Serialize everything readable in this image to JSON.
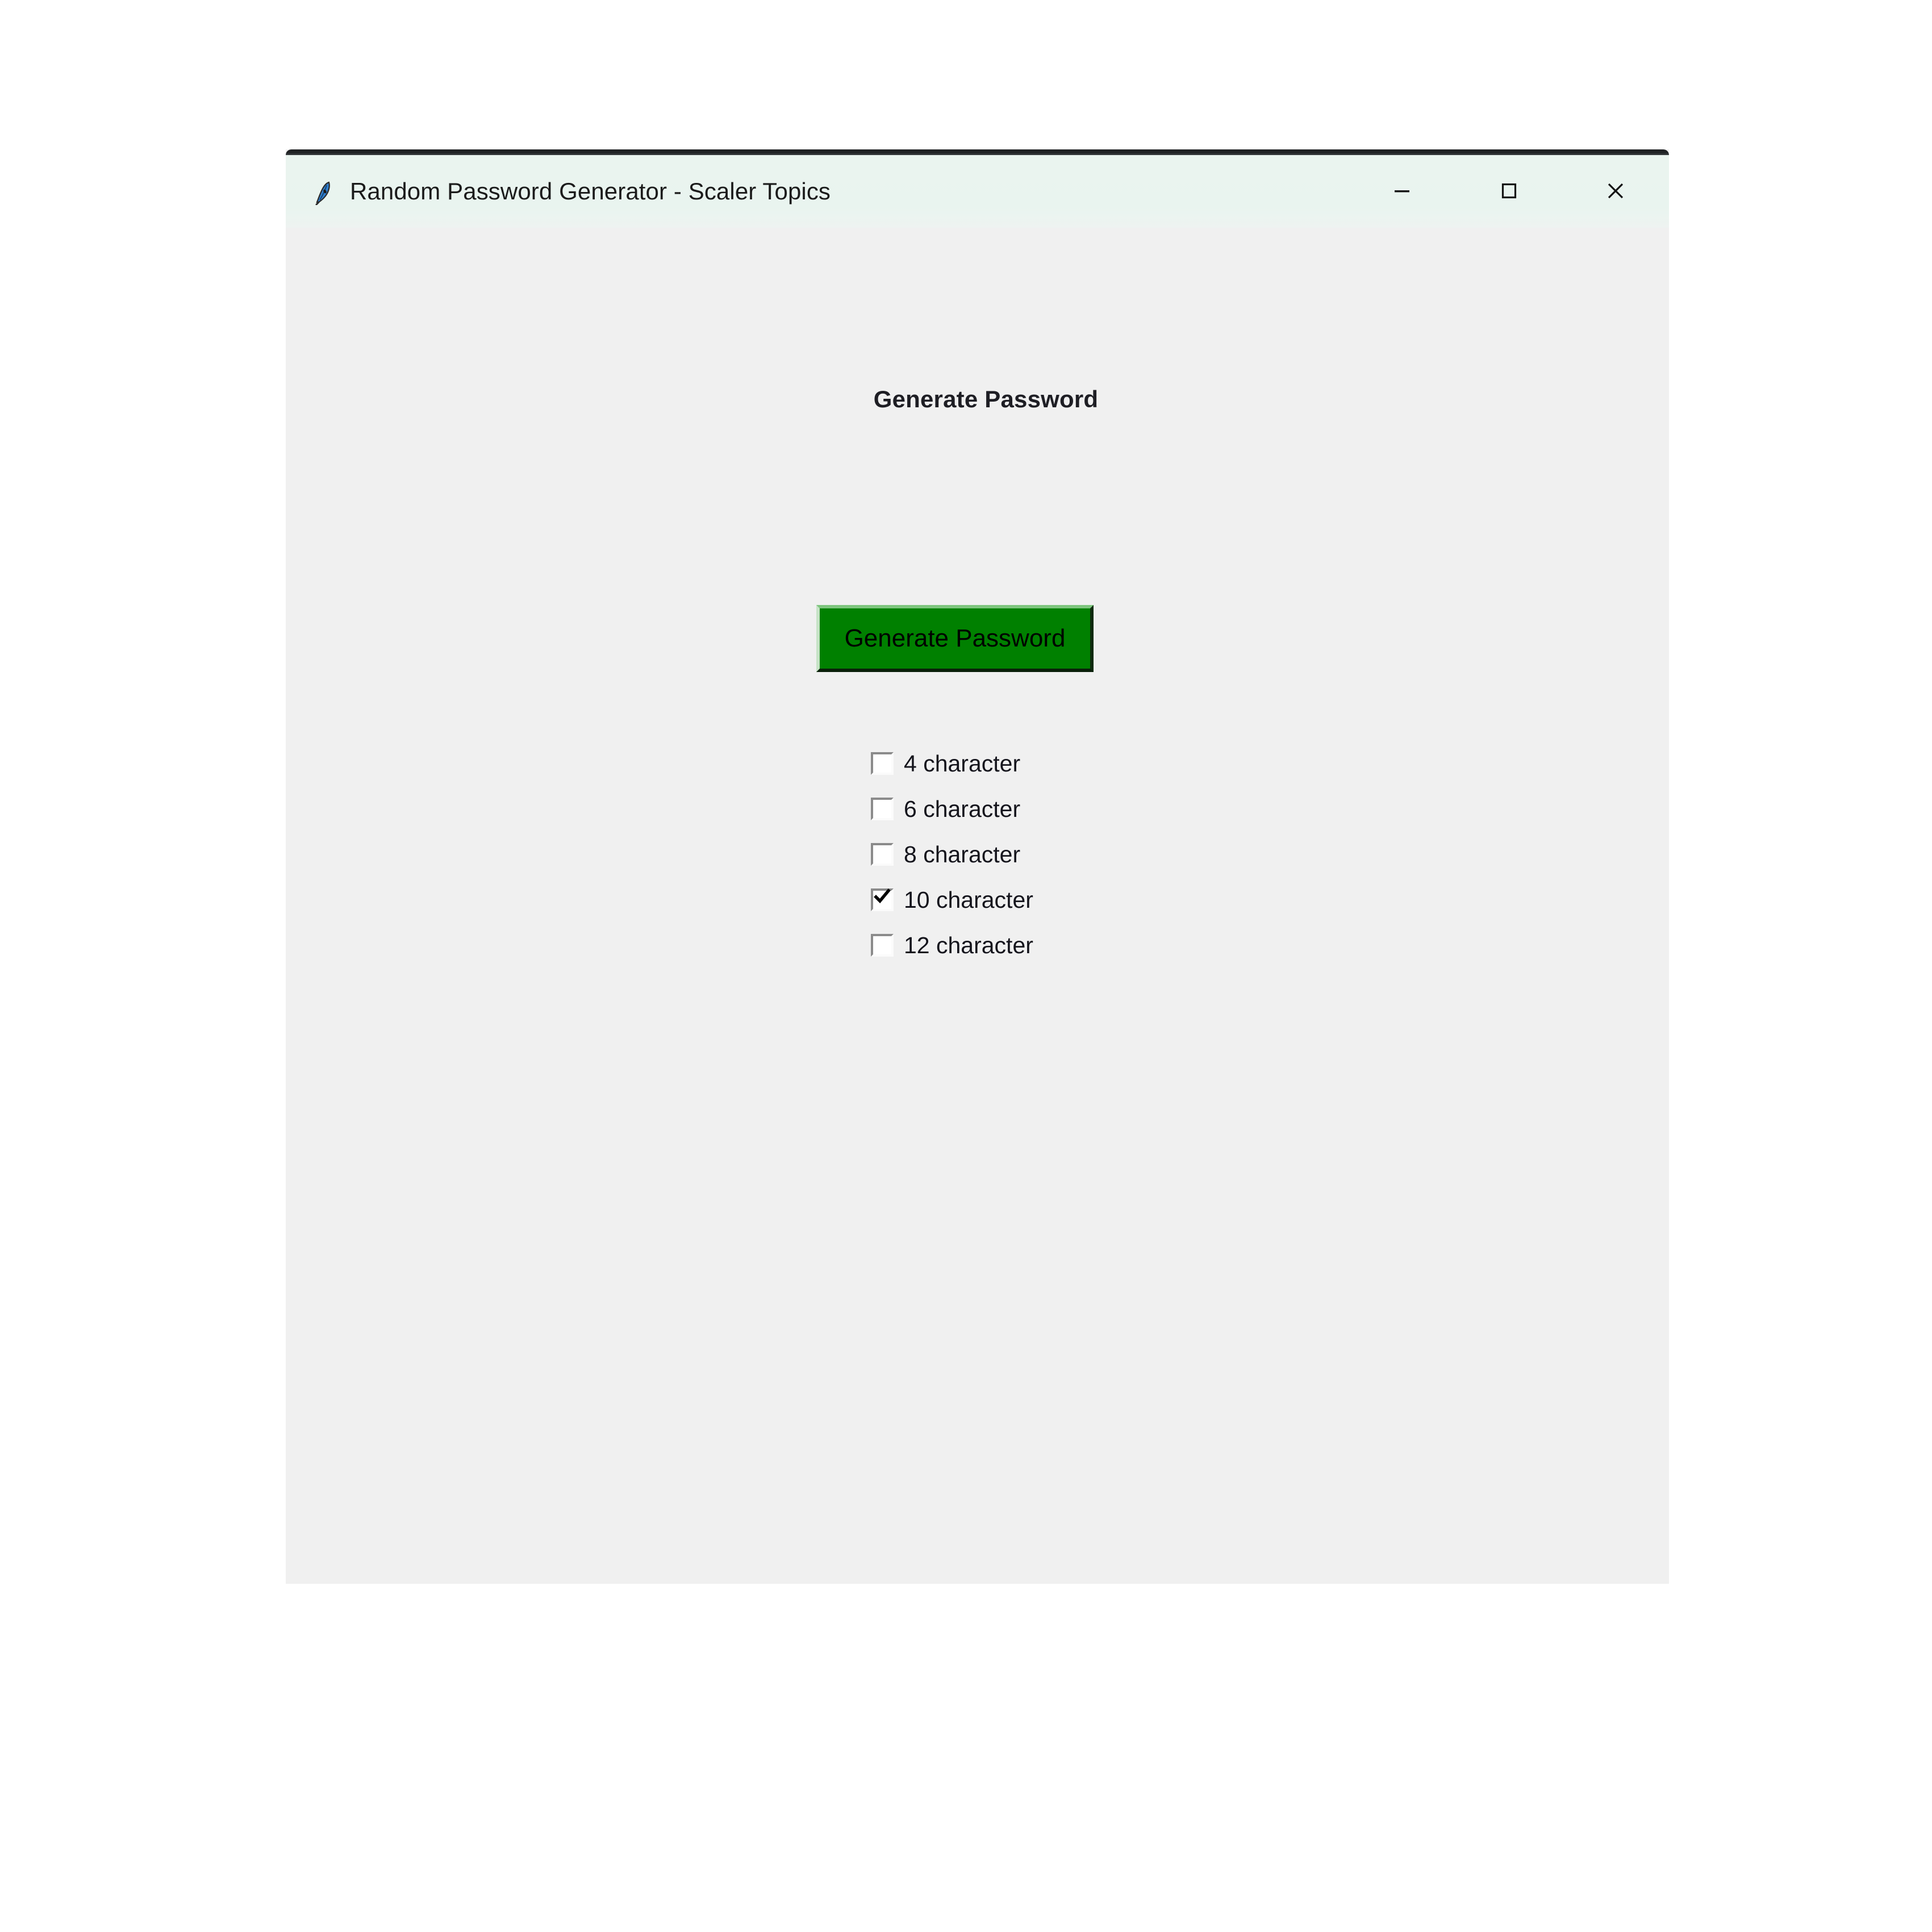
{
  "window": {
    "title": "Random Password Generator - Scaler Topics",
    "icon": "tkinter-feather-icon",
    "background_color": "#f0f0f0",
    "titlebar_color": "#eaf4ef",
    "controls": {
      "minimize_label": "Minimize",
      "maximize_label": "Maximize",
      "close_label": "Close"
    }
  },
  "main": {
    "heading": "Generate Password",
    "generate_button": {
      "label": "Generate Password",
      "background_color": "#008000",
      "text_color": "#000000"
    },
    "options": {
      "items": [
        {
          "label": "4 character",
          "checked": false
        },
        {
          "label": "6 character",
          "checked": false
        },
        {
          "label": "8 character",
          "checked": false
        },
        {
          "label": "10 character",
          "checked": true
        },
        {
          "label": "12 character",
          "checked": false
        }
      ]
    }
  }
}
